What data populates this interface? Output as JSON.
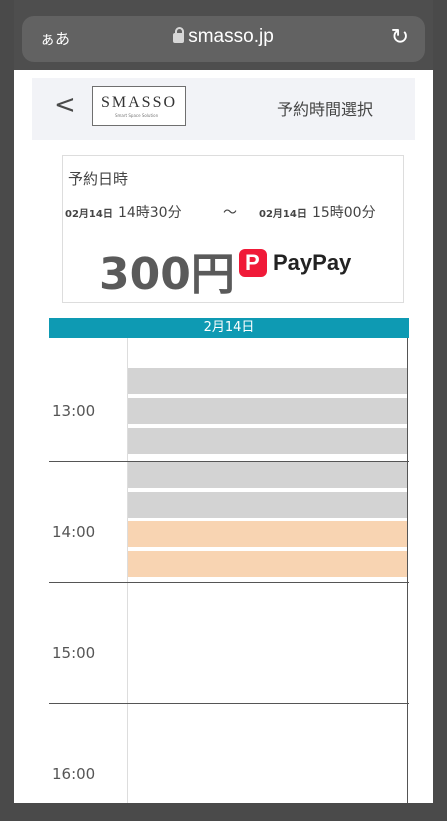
{
  "browser": {
    "aa_label": "ぁあ",
    "url": "smasso.jp"
  },
  "header": {
    "back_glyph": "<",
    "logo_text": "SMASSO",
    "logo_subtitle": "Smart Space Solution",
    "title": "予約時間選択"
  },
  "reservation": {
    "label": "予約日時",
    "start_date": "02月14日",
    "start_time": "14時30分",
    "separator": "〜",
    "end_date": "02月14日",
    "end_time": "15時00分",
    "price": "300円",
    "payment_brand": "PayPay"
  },
  "calendar": {
    "date_label": "2月14日",
    "hours": [
      "13:00",
      "14:00",
      "15:00",
      "16:00"
    ],
    "slot_states": [
      "booked",
      "booked",
      "booked",
      "booked",
      "booked",
      "selected",
      "selected"
    ]
  },
  "colors": {
    "calendar_header": "#0e9ab3",
    "booked_slot": "#d3d3d3",
    "selected_slot": "#f8d4b2",
    "paypay_red": "#f01a38"
  }
}
